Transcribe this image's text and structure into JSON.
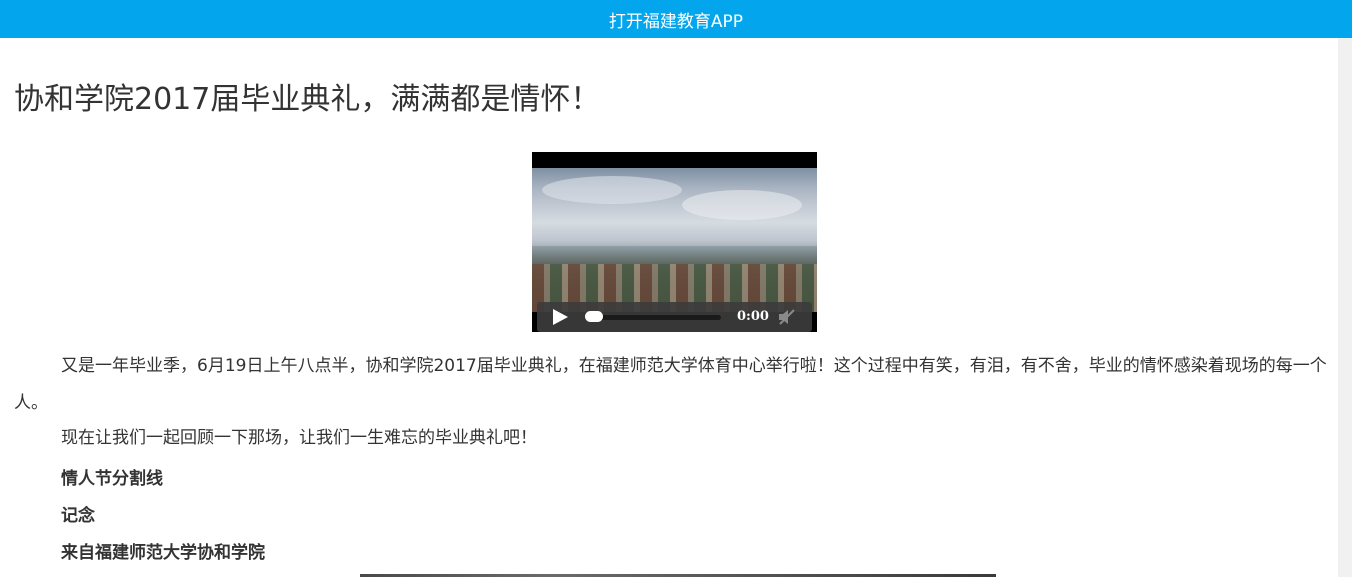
{
  "header": {
    "open_app_label": "打开福建教育APP",
    "bg_color": "#03a6ed"
  },
  "article": {
    "title": "协和学院2017届毕业典礼，满满都是情怀！",
    "video": {
      "time": "0:00",
      "play_icon": "play-icon",
      "mute_icon": "speaker-muted-icon"
    },
    "paragraphs": [
      "又是一年毕业季，6月19日上午八点半，协和学院2017届毕业典礼，在福建师范大学体育中心举行啦！这个过程中有笑，有泪，有不舍，毕业的情怀感染着现场的每一个人。",
      "现在让我们一起回顾一下那场，让我们一生难忘的毕业典礼吧！"
    ],
    "bold_lines": [
      "情人节分割线",
      "记念",
      "来自福建师范大学协和学院"
    ]
  }
}
